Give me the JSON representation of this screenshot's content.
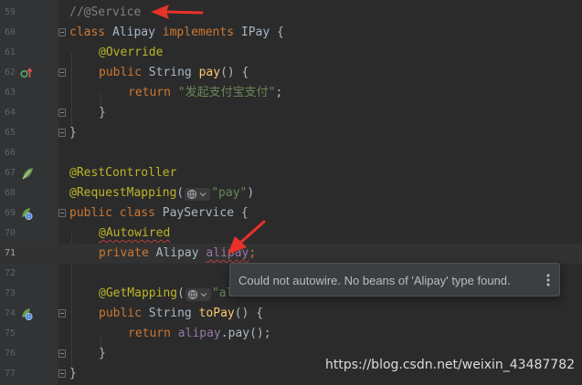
{
  "editor": {
    "current_line": "71",
    "lines": [
      {
        "num": "59",
        "code": "//@Service"
      },
      {
        "num": "60",
        "code": "class Alipay implements IPay {"
      },
      {
        "num": "61",
        "code": "@Override"
      },
      {
        "num": "62",
        "code": "public String pay() {"
      },
      {
        "num": "63",
        "code": "return \"发起支付宝支付\";"
      },
      {
        "num": "64",
        "code": "}"
      },
      {
        "num": "65",
        "code": "}"
      },
      {
        "num": "66",
        "code": ""
      },
      {
        "num": "67",
        "code": "@RestController"
      },
      {
        "num": "68",
        "code": "@RequestMapping(\"pay\")"
      },
      {
        "num": "69",
        "code": "public class PayService {"
      },
      {
        "num": "70",
        "code": "@Autowired"
      },
      {
        "num": "71",
        "code": "private Alipay alipay;"
      },
      {
        "num": "72",
        "code": ""
      },
      {
        "num": "73",
        "code": "@GetMapping(\"ali"
      },
      {
        "num": "74",
        "code": "public String toPay() {"
      },
      {
        "num": "75",
        "code": "return alipay.pay();"
      },
      {
        "num": "76",
        "code": "}"
      },
      {
        "num": "77",
        "code": "}"
      }
    ]
  },
  "tooltip": {
    "message": "Could not autowire. No beans of 'Alipay' type found."
  },
  "watermark": {
    "text": "https://blog.csdn.net/weixin_43487782"
  },
  "icons": {
    "overrides": "overrides-method-icon",
    "spring_bean": "spring-bean-icon",
    "web_request": "web-request-mapping-icon",
    "fold": "fold-marker-icon",
    "inlay_globe": "url-globe-inlay-icon",
    "tooltip_more": "more-vertical-icon",
    "arrow": "red-annotation-arrow"
  },
  "colors": {
    "background": "#2b2b2b",
    "gutter": "#313335",
    "keyword": "#cc7832",
    "annotation": "#bbb529",
    "string": "#6a8759",
    "comment": "#808080",
    "method": "#ffc66d",
    "field": "#9876aa",
    "text": "#a9b7c6",
    "error_underline": "#bc3f3c",
    "arrow": "#e8312a"
  }
}
